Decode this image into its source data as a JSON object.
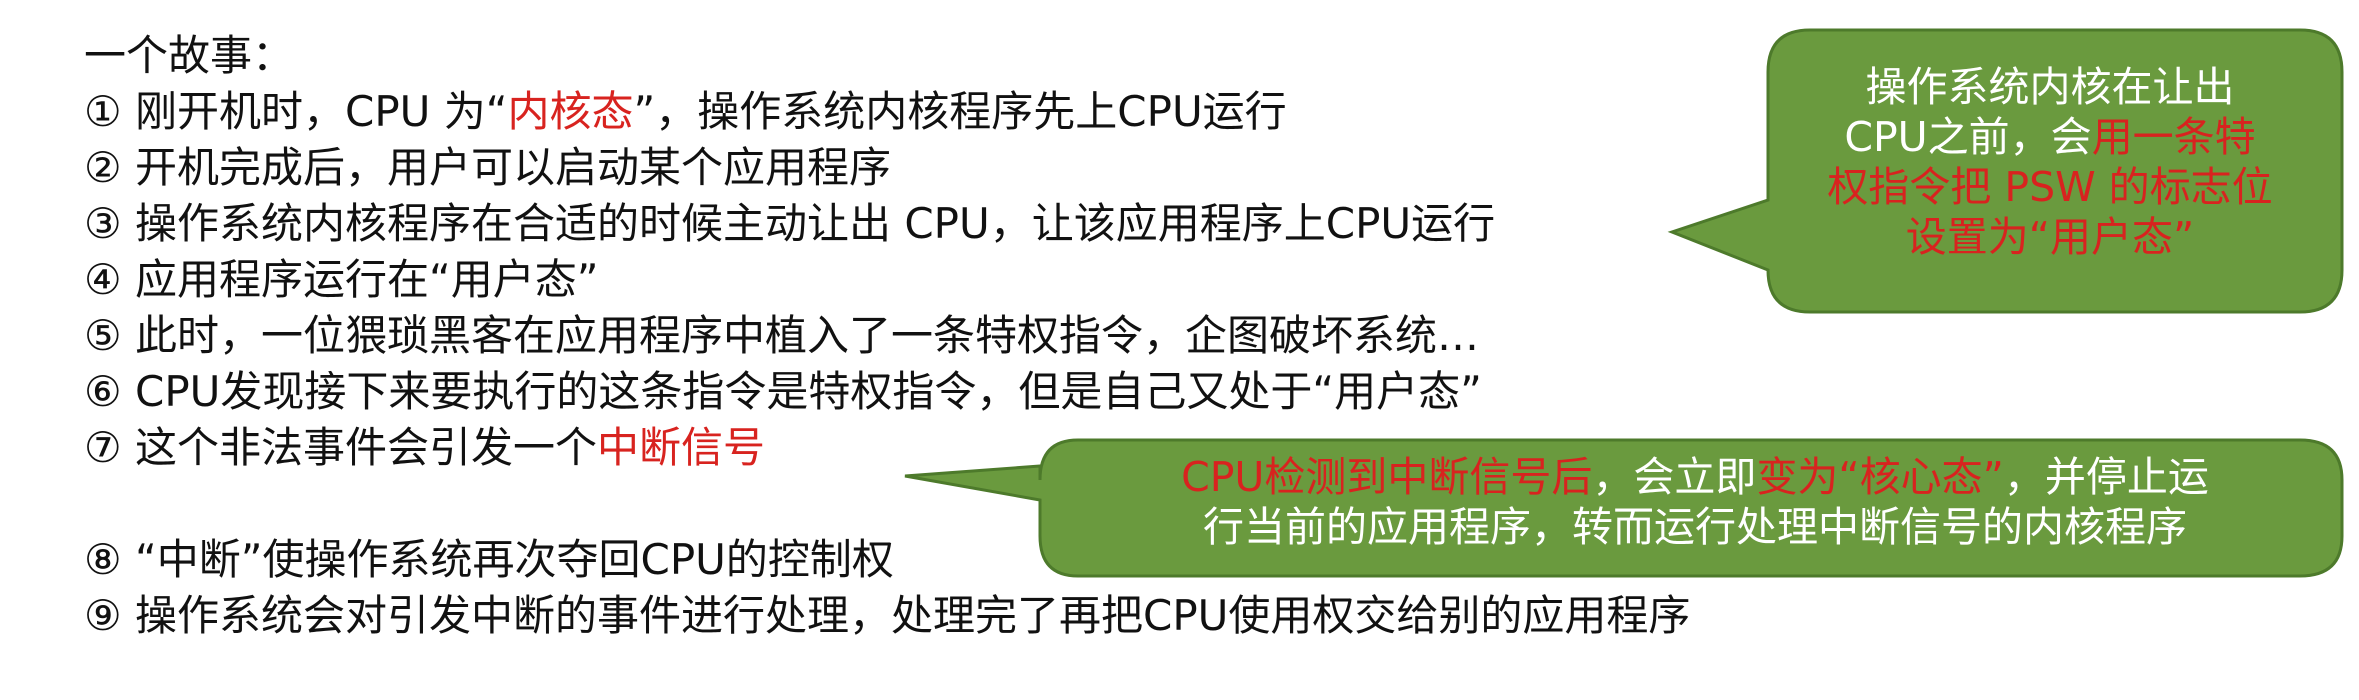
{
  "story": {
    "title": "一个故事：",
    "lines": [
      {
        "parts": [
          {
            "text": "① 刚开机时，CPU 为“",
            "hl": false
          },
          {
            "text": "内核态",
            "hl": true
          },
          {
            "text": "”，操作系统内核程序先上CPU运行",
            "hl": false
          }
        ]
      },
      {
        "parts": [
          {
            "text": "② 开机完成后，用户可以启动某个应用程序",
            "hl": false
          }
        ]
      },
      {
        "parts": [
          {
            "text": "③ 操作系统内核程序在合适的时候主动让出 CPU，让该应用程序上CPU运行",
            "hl": false
          }
        ]
      },
      {
        "parts": [
          {
            "text": "④ 应用程序运行在“用户态”",
            "hl": false
          }
        ]
      },
      {
        "parts": [
          {
            "text": "⑤ 此时，一位猥琐黑客在应用程序中植入了一条特权指令，企图破坏系统…",
            "hl": false
          }
        ]
      },
      {
        "parts": [
          {
            "text": "⑥ CPU发现接下来要执行的这条指令是特权指令，但是自己又处于“用户态”",
            "hl": false
          }
        ]
      },
      {
        "parts": [
          {
            "text": "⑦ 这个非法事件会引发一个",
            "hl": false
          },
          {
            "text": "中断信号",
            "hl": true
          }
        ]
      },
      {
        "parts": [
          {
            "text": "⑧ “中断”使操作系统再次夺回CPU的控制权",
            "hl": false
          }
        ]
      },
      {
        "parts": [
          {
            "text": "⑨ 操作系统会对引发中断的事件进行处理，处理完了再把CPU使用权交给别的应用程序",
            "hl": false
          }
        ]
      }
    ]
  },
  "callout_top": {
    "line1": "操作系统内核在让出",
    "line2_plain": "CPU之前，会",
    "line2_hl": "用一条特",
    "line3_hl": "权指令把 PSW 的标志位",
    "line4_hl": "设置为“用户态”"
  },
  "callout_bottom": {
    "line1_hl_a": "CPU检测到中断信号后",
    "line1_plain_a": "，会立即",
    "line1_hl_b": "变为“核心态”",
    "line1_plain_b": "，并停止运",
    "line2": "行当前的应用程序，转而运行处理中断信号的内核程序"
  },
  "colors": {
    "bubble_fill": "#6a9a3e",
    "bubble_stroke": "#4d7a2b",
    "highlight": "#d8231f"
  }
}
